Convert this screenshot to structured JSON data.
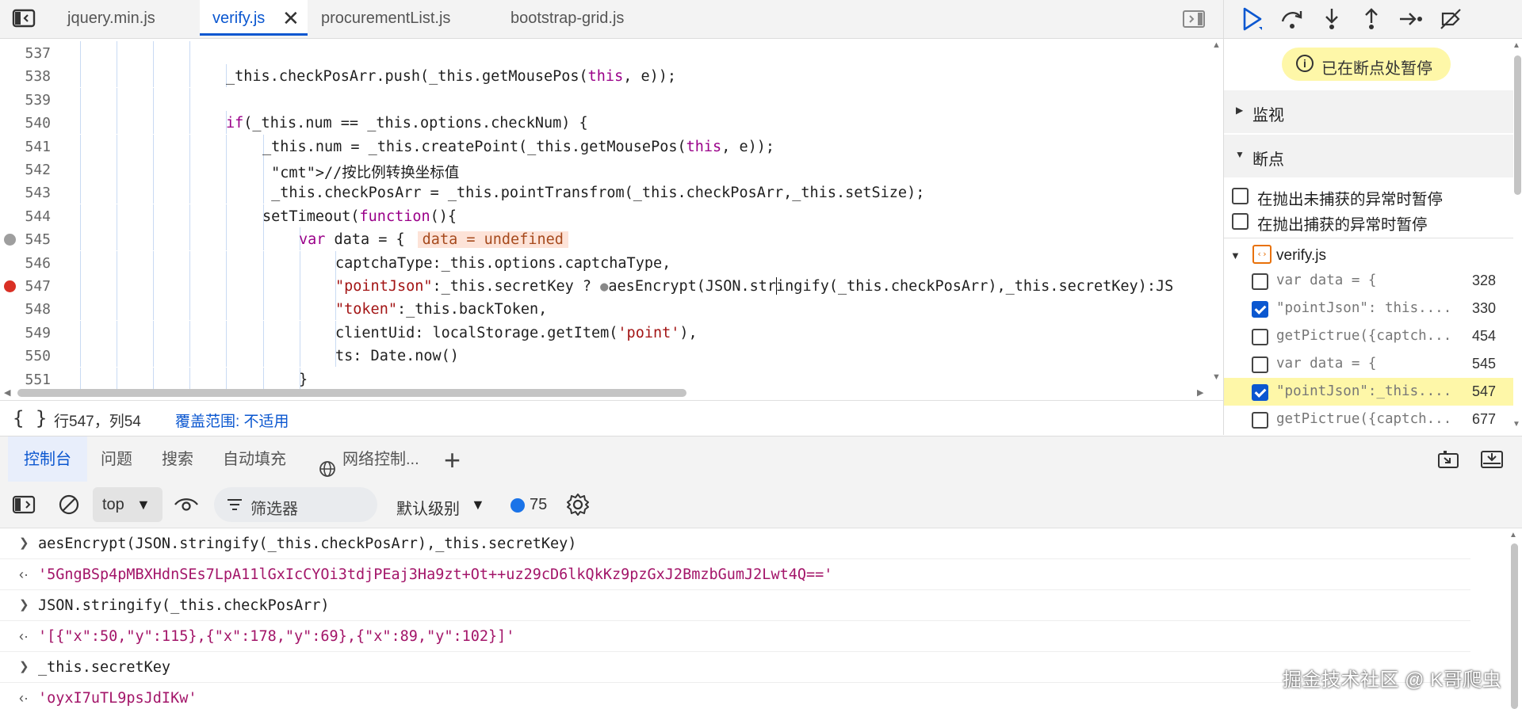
{
  "tabs": [
    {
      "label": "jquery.min.js",
      "active": false
    },
    {
      "label": "verify.js",
      "active": true
    },
    {
      "label": "procurementList.js",
      "active": false
    },
    {
      "label": "bootstrap-grid.js",
      "active": false
    }
  ],
  "editor": {
    "lines": [
      {
        "num": "537",
        "indent": 0,
        "code": ""
      },
      {
        "num": "538",
        "indent": 5,
        "code": "_this.checkPosArr.push(_this.getMousePos(this, e));"
      },
      {
        "num": "539",
        "indent": 0,
        "code": ""
      },
      {
        "num": "540",
        "indent": 5,
        "code": "if(_this.num == _this.options.checkNum) {"
      },
      {
        "num": "541",
        "indent": 6,
        "code": "_this.num = _this.createPoint(_this.getMousePos(this, e));"
      },
      {
        "num": "542",
        "indent": 6,
        "code": " //按比例转换坐标值"
      },
      {
        "num": "543",
        "indent": 6,
        "code": " _this.checkPosArr = _this.pointTransfrom(_this.checkPosArr,_this.setSize);"
      },
      {
        "num": "544",
        "indent": 6,
        "code": "setTimeout(function(){"
      },
      {
        "num": "545",
        "indent": 7,
        "code": "var data = {",
        "inline": "data = undefined"
      },
      {
        "num": "546",
        "indent": 8,
        "code": "captchaType:_this.options.captchaType,"
      },
      {
        "num": "547",
        "indent": 8,
        "code": "\"pointJson\":_this.secretKey ? ⬤aesEncrypt(JSON.stringify(_this.checkPosArr),_this.secretKey):JS"
      },
      {
        "num": "548",
        "indent": 8,
        "code": "\"token\":_this.backToken,"
      },
      {
        "num": "549",
        "indent": 8,
        "code": "clientUid: localStorage.getItem('point'),"
      },
      {
        "num": "550",
        "indent": 8,
        "code": "ts: Date.now()"
      },
      {
        "num": "551",
        "indent": 7,
        "code": "}"
      }
    ]
  },
  "status": {
    "braces": "{ }",
    "position": "行547，列54",
    "coverage": "覆盖范围: 不适用"
  },
  "debugger": {
    "paused_label": "已在断点处暂停",
    "watch_label": "监视",
    "breakpoints_label": "断点",
    "pause_uncaught": "在抛出未捕获的异常时暂停",
    "pause_caught": "在抛出捕获的异常时暂停",
    "file": "verify.js",
    "breakpoints": [
      {
        "code": "var data = {",
        "line": "328",
        "checked": false,
        "highlight": false
      },
      {
        "code": "\"pointJson\": this....",
        "line": "330",
        "checked": true,
        "highlight": false
      },
      {
        "code": "getPictrue({captch...",
        "line": "454",
        "checked": false,
        "highlight": false
      },
      {
        "code": "var data = {",
        "line": "545",
        "checked": false,
        "highlight": false
      },
      {
        "code": "\"pointJson\":_this....",
        "line": "547",
        "checked": true,
        "highlight": true
      },
      {
        "code": "getPictrue({captch...",
        "line": "677",
        "checked": false,
        "highlight": false
      }
    ]
  },
  "drawer": {
    "tabs": [
      "控制台",
      "问题",
      "搜索",
      "自动填充",
      "网络控制..."
    ]
  },
  "console_toolbar": {
    "context": "top",
    "filter_placeholder": "筛选器",
    "level": "默认级别",
    "message_count": "75"
  },
  "console": {
    "entries": [
      {
        "type": "input",
        "text": "aesEncrypt(JSON.stringify(_this.checkPosArr),_this.secretKey)"
      },
      {
        "type": "output",
        "text": "'5GngBSp4pMBXHdnSEs7LpA11lGxIcCYOi3tdjPEaj3Ha9zt+Ot++uz29cD6lkQkKz9pzGxJ2BmzbGumJ2Lwt4Q=='"
      },
      {
        "type": "input",
        "text": "JSON.stringify(_this.checkPosArr)"
      },
      {
        "type": "output",
        "text": "'[{\"x\":50,\"y\":115},{\"x\":178,\"y\":69},{\"x\":89,\"y\":102}]'"
      },
      {
        "type": "input",
        "text": "_this.secretKey"
      },
      {
        "type": "output",
        "text": "'oyxI7uTL9psJdIKw'"
      }
    ]
  },
  "watermark": "掘金技术社区 @ K哥爬虫",
  "colors": {
    "accent": "#0b57d0",
    "breakpoint_red": "#d93025",
    "breakpoint_gray": "#9e9e9e",
    "paused_banner": "#fef7a8"
  }
}
